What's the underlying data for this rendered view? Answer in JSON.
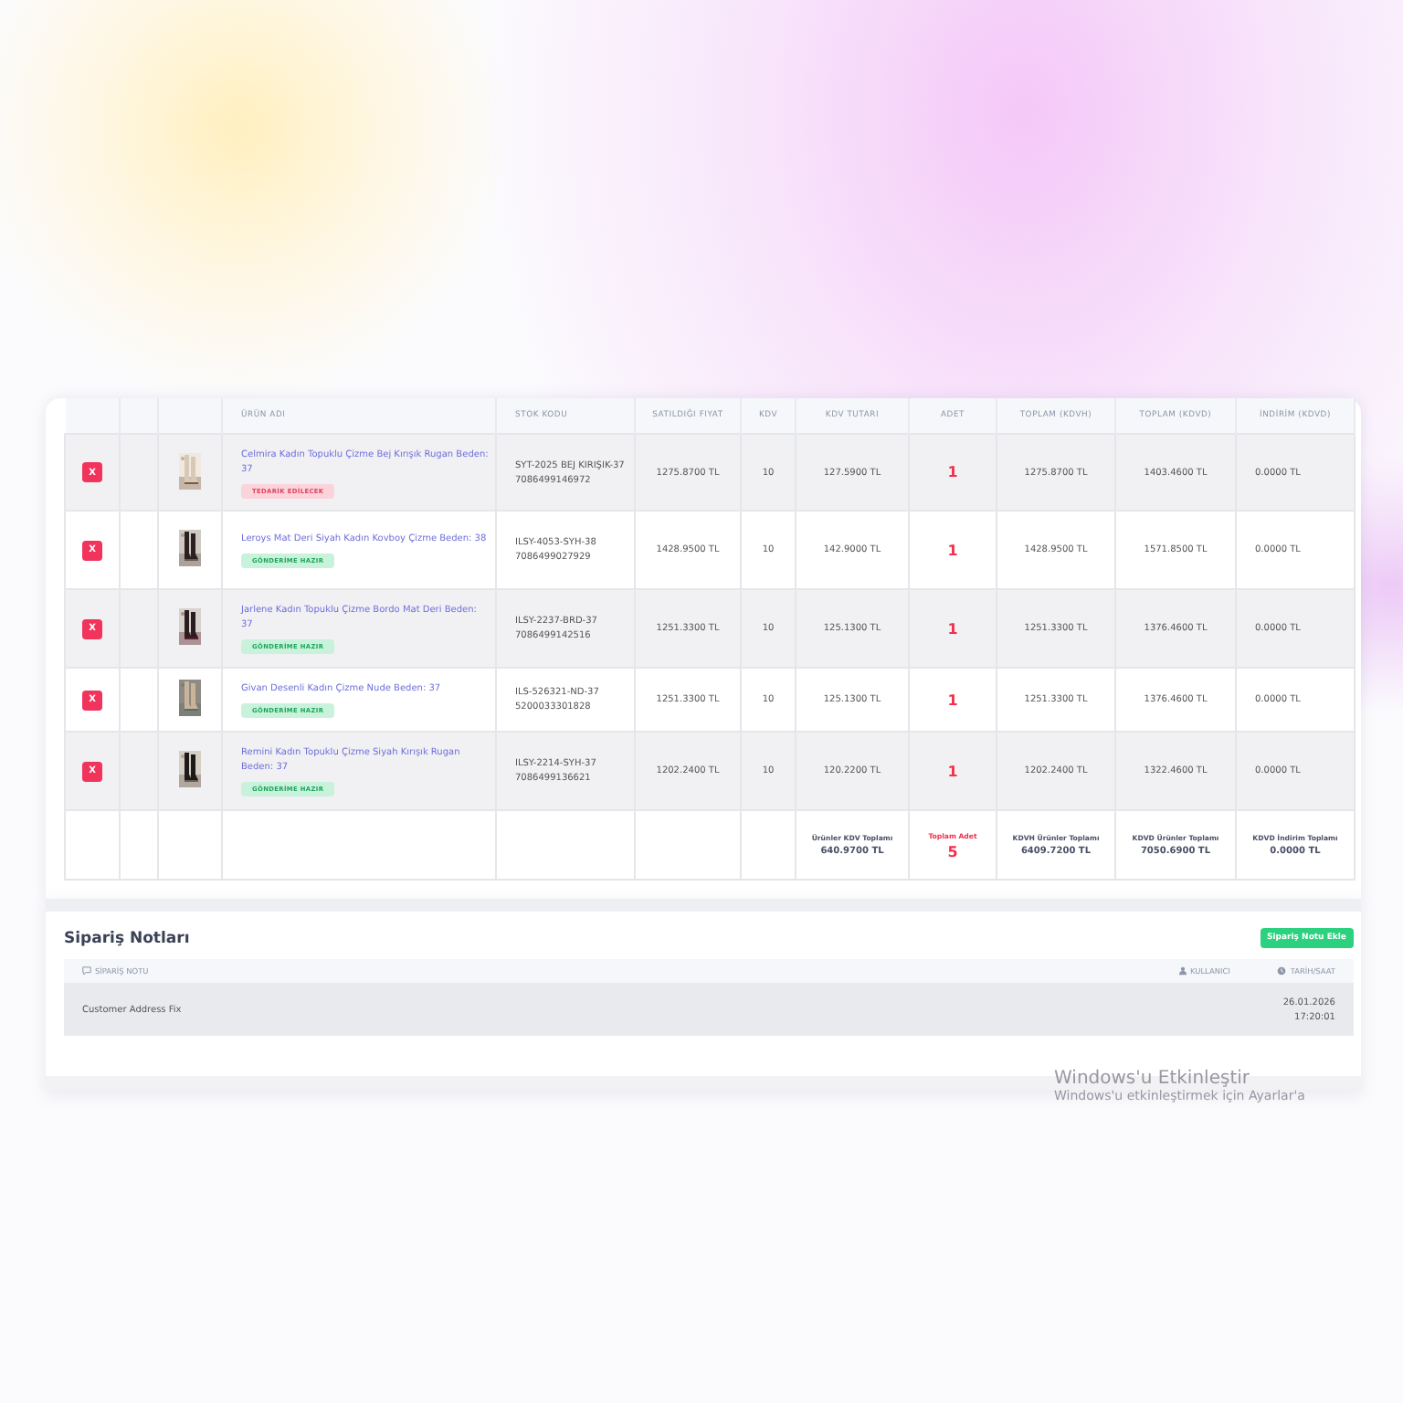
{
  "order_table": {
    "columns": [
      "ÜRÜN ADI",
      "STOK KODU",
      "SATILDIĞI FIYAT",
      "KDV",
      "KDV TUTARI",
      "ADET",
      "TOPLAM (KDVH)",
      "TOPLAM (KDVD)",
      "İNDİRİM (KDVD)"
    ],
    "rows": [
      {
        "delete": "X",
        "product": "Celmira Kadın Topuklu Çizme Bej Kırışık Rugan Beden: 37",
        "status": {
          "kind": "pending",
          "label": "TEDARİK EDİLECEK"
        },
        "stock_code": "SYT-2025 BEJ KIRIŞIK-37",
        "barcode": "7086499146972",
        "price": "1275.8700 TL",
        "vat": "10",
        "vat_amount": "127.5900 TL",
        "quantity": "1",
        "total_excl": "1275.8700 TL",
        "total_incl": "1403.4600 TL",
        "discount": "0.0000 TL"
      },
      {
        "delete": "X",
        "product": "Leroys Mat Deri Siyah Kadın Kovboy Çizme Beden: 38",
        "status": {
          "kind": "ready",
          "label": "GÖNDERİME HAZIR"
        },
        "stock_code": "ILSY-4053-SYH-38",
        "barcode": "7086499027929",
        "price": "1428.9500 TL",
        "vat": "10",
        "vat_amount": "142.9000 TL",
        "quantity": "1",
        "total_excl": "1428.9500 TL",
        "total_incl": "1571.8500 TL",
        "discount": "0.0000 TL"
      },
      {
        "delete": "X",
        "product": "Jarlene Kadın Topuklu Çizme Bordo Mat Deri Beden: 37",
        "status": {
          "kind": "ready",
          "label": "GÖNDERİME HAZIR"
        },
        "stock_code": "ILSY-2237-BRD-37",
        "barcode": "7086499142516",
        "price": "1251.3300 TL",
        "vat": "10",
        "vat_amount": "125.1300 TL",
        "quantity": "1",
        "total_excl": "1251.3300 TL",
        "total_incl": "1376.4600 TL",
        "discount": "0.0000 TL"
      },
      {
        "delete": "X",
        "product": "Givan Desenli Kadın Çizme Nude Beden: 37",
        "status": {
          "kind": "ready",
          "label": "GÖNDERİME HAZIR"
        },
        "stock_code": "ILS-526321-ND-37",
        "barcode": "5200033301828",
        "price": "1251.3300 TL",
        "vat": "10",
        "vat_amount": "125.1300 TL",
        "quantity": "1",
        "total_excl": "1251.3300 TL",
        "total_incl": "1376.4600 TL",
        "discount": "0.0000 TL"
      },
      {
        "delete": "X",
        "product": "Remini Kadın Topuklu Çizme Siyah Kırışık Rugan Beden: 37",
        "status": {
          "kind": "ready",
          "label": "GÖNDERİME HAZIR"
        },
        "stock_code": "ILSY-2214-SYH-37",
        "barcode": "7086499136621",
        "price": "1202.2400 TL",
        "vat": "10",
        "vat_amount": "120.2200 TL",
        "quantity": "1",
        "total_excl": "1202.2400 TL",
        "total_incl": "1322.4600 TL",
        "discount": "0.0000 TL"
      }
    ],
    "totals": [
      {
        "label": "Ürünler KDV Toplamı",
        "value": "640.9700 TL",
        "kind": "plain"
      },
      {
        "label": "Toplam Adet",
        "value": "5",
        "kind": "count"
      },
      {
        "label": "KDVH Ürünler Toplamı",
        "value": "6409.7200 TL",
        "kind": "plain"
      },
      {
        "label": "KDVD Ürünler Toplamı",
        "value": "7050.6900 TL",
        "kind": "plain"
      },
      {
        "label": "KDVD İndirim Toplamı",
        "value": "0.0000 TL",
        "kind": "plain"
      }
    ]
  },
  "order_notes": {
    "title": "Sipariş Notları",
    "add_button": "Sipariş Notu Ekle",
    "columns": [
      {
        "label": "SİPARİŞ NOTU",
        "kind": "note"
      },
      {
        "label": "KULLANICI",
        "kind": "user"
      },
      {
        "label": "TARİH/SAAT",
        "kind": "time"
      }
    ],
    "rows": [
      {
        "note": "Customer Address Fix",
        "date": "26.01.2026",
        "time": "17:20:01"
      }
    ]
  },
  "activation_notice": {
    "title": "Windows'u Etkinleştir",
    "text": "Windows'u etkinleştirmek için Ayarlar'a"
  }
}
